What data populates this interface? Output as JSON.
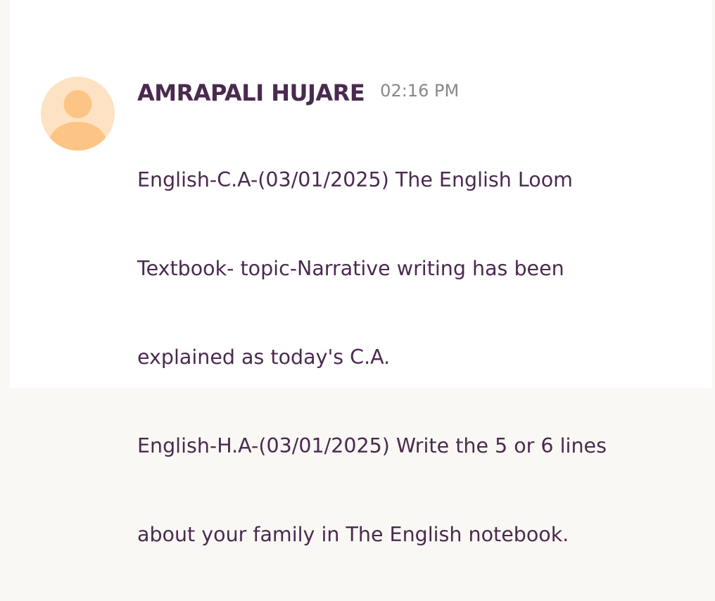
{
  "message": {
    "author": "AMRAPALI HUJARE",
    "time": "02:16 PM",
    "lines": [
      "English-C.A-(03/01/2025) The English Loom",
      "Textbook- topic-Narrative writing has been",
      "explained as today's C.A.",
      "English-H.A-(03/01/2025) Write the 5 or 6 lines",
      "about your family in The English notebook."
    ],
    "avatar_icon": "user-avatar-icon"
  },
  "colors": {
    "text": "#4a2a4f",
    "muted": "#8a8490",
    "avatar_bg": "#fde3c3",
    "avatar_fg": "#fdc585"
  }
}
